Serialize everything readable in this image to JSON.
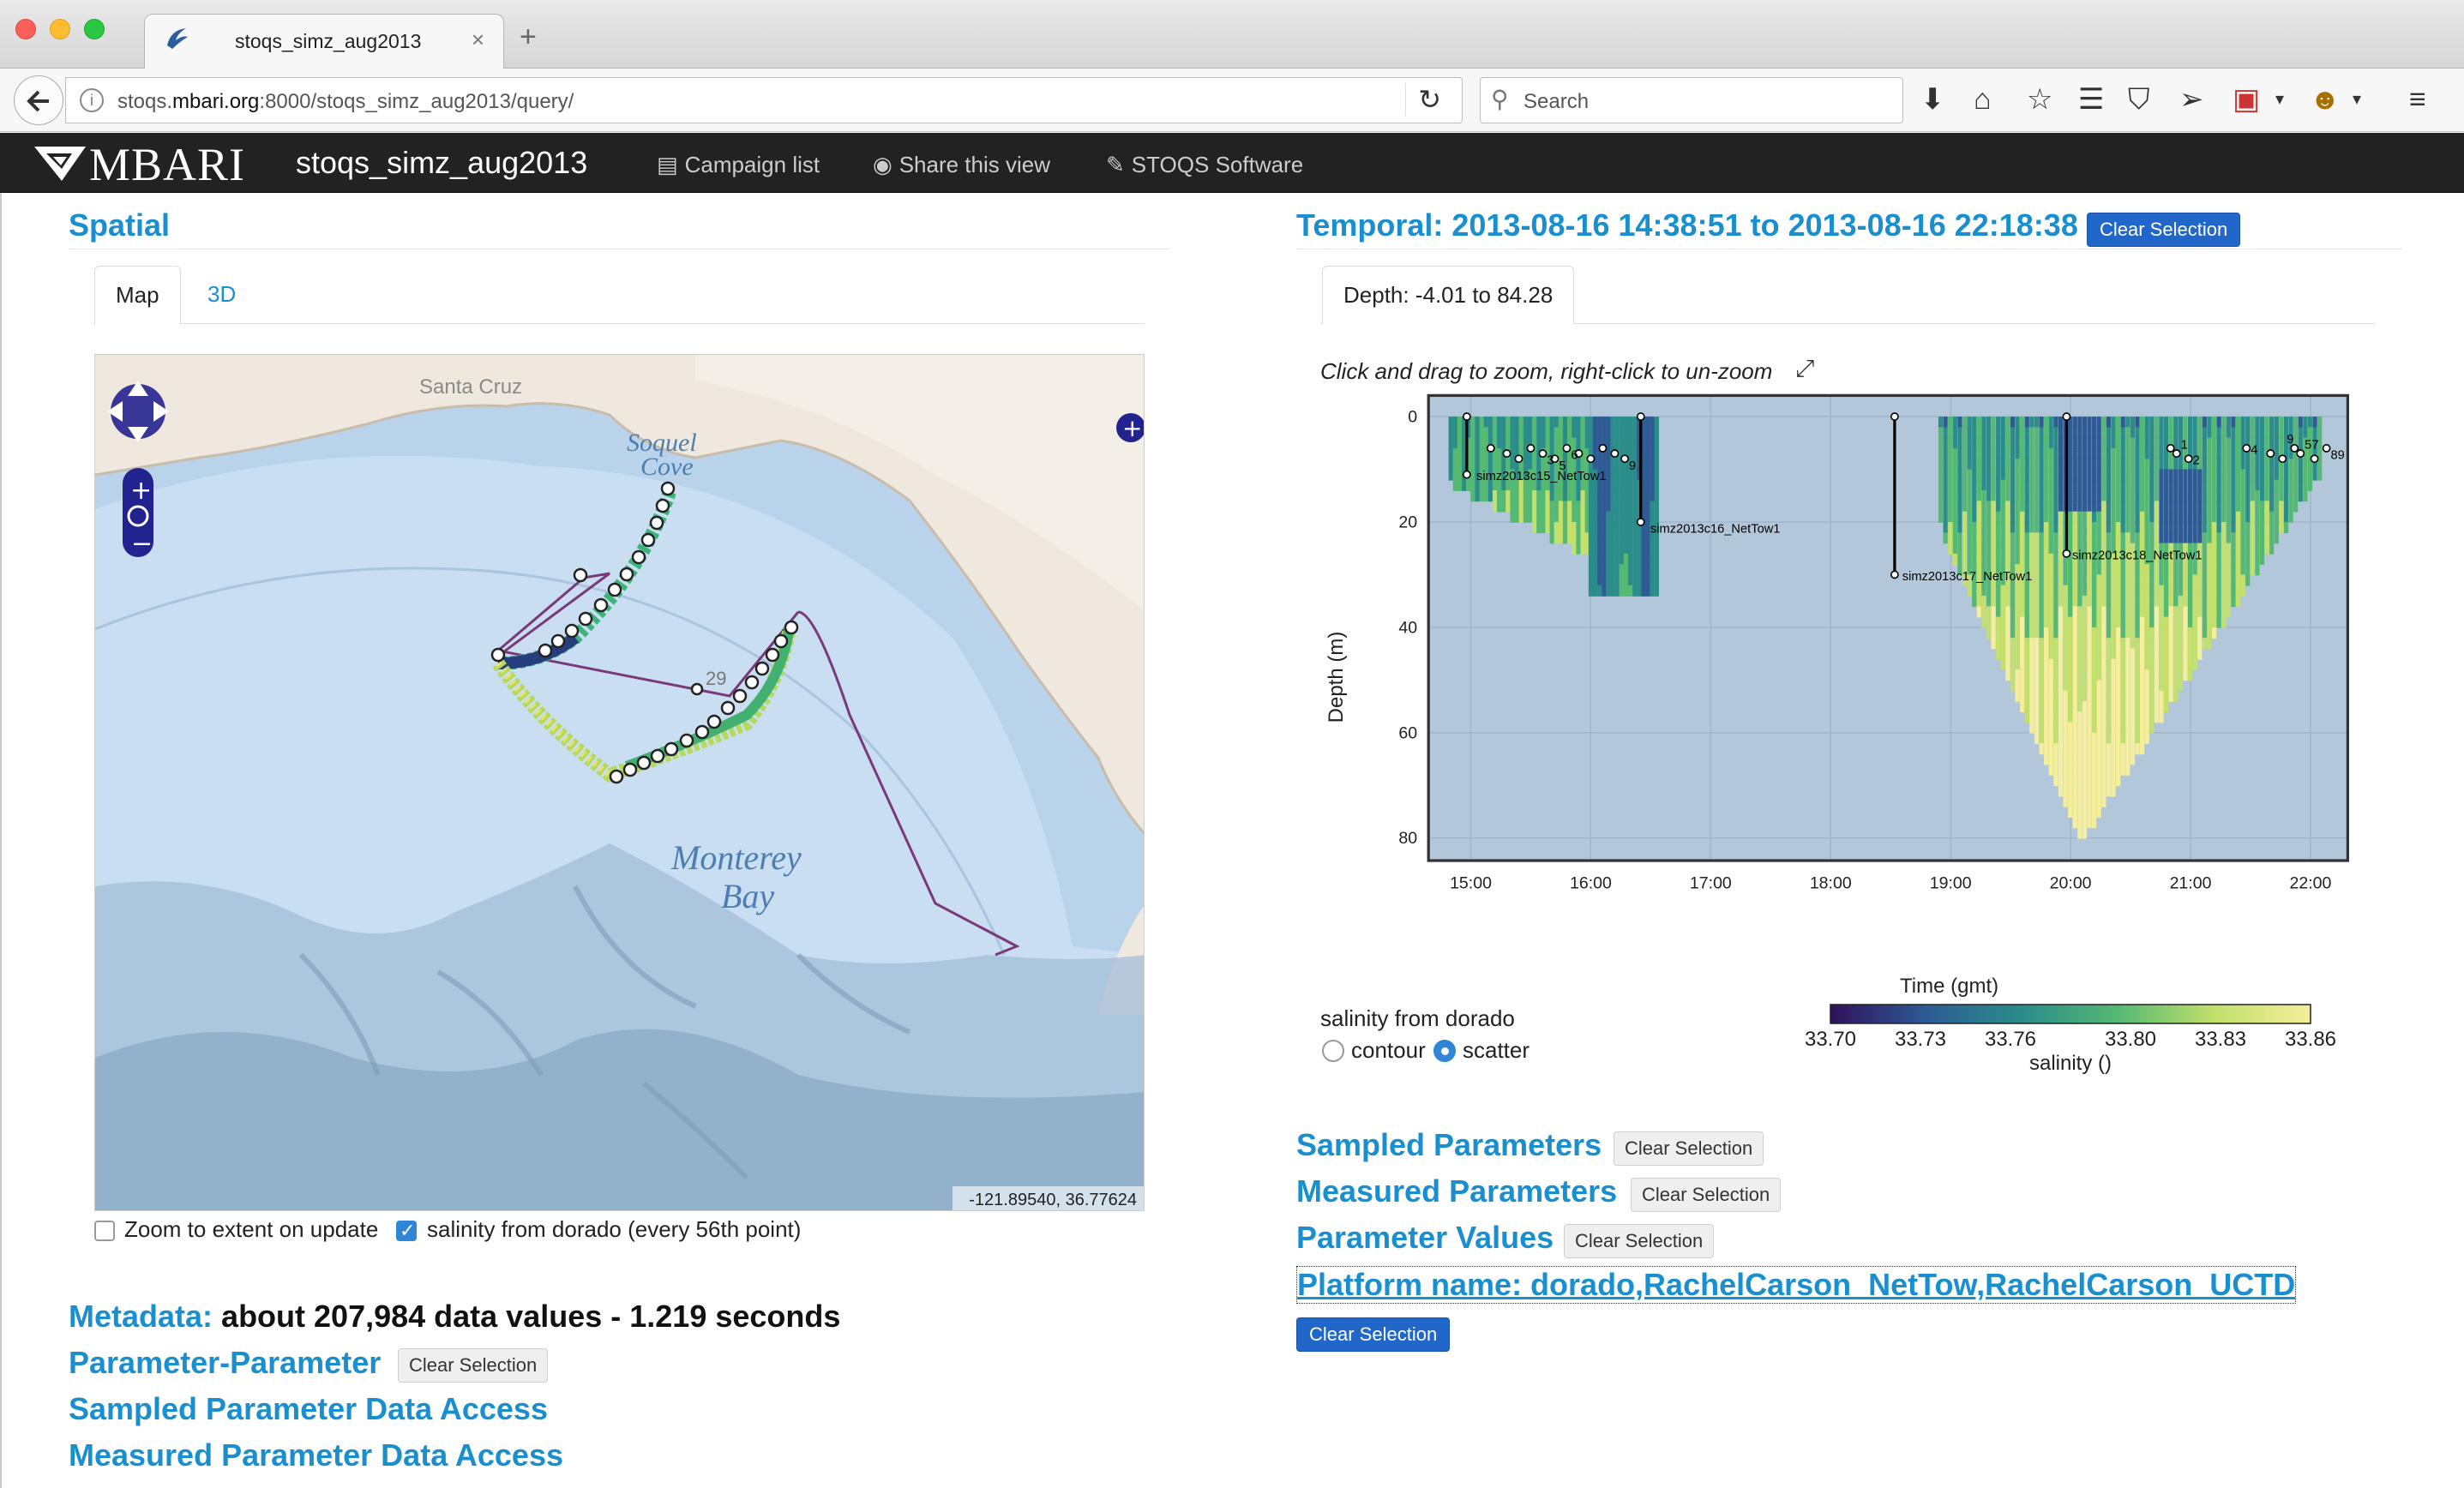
{
  "browser": {
    "tab_title": "stoqs_simz_aug2013",
    "url_prefix": "stoqs.",
    "url_domain": "mbari.org",
    "url_rest": ":8000/stoqs_simz_aug2013/query/",
    "search_placeholder": "Search"
  },
  "navbar": {
    "brand": "MBARI",
    "campaign": "stoqs_simz_aug2013",
    "links": [
      "Campaign list",
      "Share this view",
      "STOQS Software"
    ]
  },
  "spatial": {
    "heading": "Spatial",
    "tabs": [
      "Map",
      "3D"
    ],
    "map_labels": {
      "santa_cruz": "Santa Cruz",
      "soquel": "Soquel",
      "cove": "Cove",
      "monterey": "Monterey",
      "bay": "Bay",
      "marker_29": "29"
    },
    "coordinates": "-121.89540, 36.77624",
    "zoom_extent_label": "Zoom to extent on update",
    "zoom_extent_checked": false,
    "layer_label": "salinity from dorado (every 56th point)",
    "layer_checked": true
  },
  "metadata": {
    "heading": "Metadata:",
    "summary": "about 207,984 data values - 1.219 seconds"
  },
  "left_sections": {
    "param_param": "Parameter-Parameter",
    "sampled_access": "Sampled Parameter Data Access",
    "measured_access": "Measured Parameter Data Access",
    "clear_label": "Clear Selection"
  },
  "temporal": {
    "heading": "Temporal: 2013-08-16 14:38:51 to 2013-08-16 22:18:38",
    "clear_label": "Clear Selection",
    "depth_tab": "Depth: -4.01 to 84.28",
    "hint": "Click and drag to zoom, right-click to un-zoom"
  },
  "chart_data": {
    "type": "scatter",
    "xlabel": "Time (gmt)",
    "ylabel": "Depth (m)",
    "x_ticks": [
      "15:00",
      "16:00",
      "17:00",
      "18:00",
      "19:00",
      "20:00",
      "21:00",
      "22:00"
    ],
    "y_ticks": [
      0,
      20,
      40,
      60,
      80
    ],
    "ylim": [
      84.28,
      -4.01
    ],
    "x_range": [
      "14:38:51",
      "22:18:38"
    ],
    "grid": true,
    "tow_labels": [
      {
        "label": "simz2013c15_NetTow1",
        "time": "15:00",
        "depth": 11
      },
      {
        "label": "simz2013c16_NetTow1",
        "time": "16:27",
        "depth": 21
      },
      {
        "label": "simz2013c17_NetTow1",
        "time": "18:33",
        "depth": 30
      },
      {
        "label": "simz2013c18_NetTow1",
        "time": "19:58",
        "depth": 26
      }
    ],
    "sample_labels": [
      {
        "label": "3",
        "time": "15:36",
        "depth": 8
      },
      {
        "label": "5",
        "time": "15:42",
        "depth": 9
      },
      {
        "label": "6",
        "time": "15:48",
        "depth": 7
      },
      {
        "label": "9",
        "time": "16:17",
        "depth": 9
      },
      {
        "label": "1",
        "time": "20:53",
        "depth": 5
      },
      {
        "label": "2",
        "time": "20:59",
        "depth": 8
      },
      {
        "label": "4",
        "time": "21:28",
        "depth": 6
      },
      {
        "label": "9",
        "time": "21:46",
        "depth": 4
      },
      {
        "label": "57",
        "time": "21:55",
        "depth": 5
      },
      {
        "label": "89",
        "time": "22:08",
        "depth": 7
      }
    ],
    "colorbar": {
      "label": "salinity ()",
      "ticks": [
        "33.70",
        "33.73",
        "33.76",
        "33.80",
        "33.83",
        "33.86"
      ],
      "colors": [
        "#30115b",
        "#2e5b93",
        "#2a8d8a",
        "#55b973",
        "#c2e06b",
        "#f5ee9a"
      ]
    },
    "legend_title": "salinity from dorado",
    "plot_types": [
      "contour",
      "scatter"
    ],
    "selected_plot_type": "scatter"
  },
  "right_sections": {
    "sampled": "Sampled Parameters",
    "measured": "Measured Parameters",
    "values": "Parameter Values",
    "platform": "Platform name: dorado,RachelCarson_NetTow,RachelCarson_UCTD",
    "clear_label": "Clear Selection"
  }
}
